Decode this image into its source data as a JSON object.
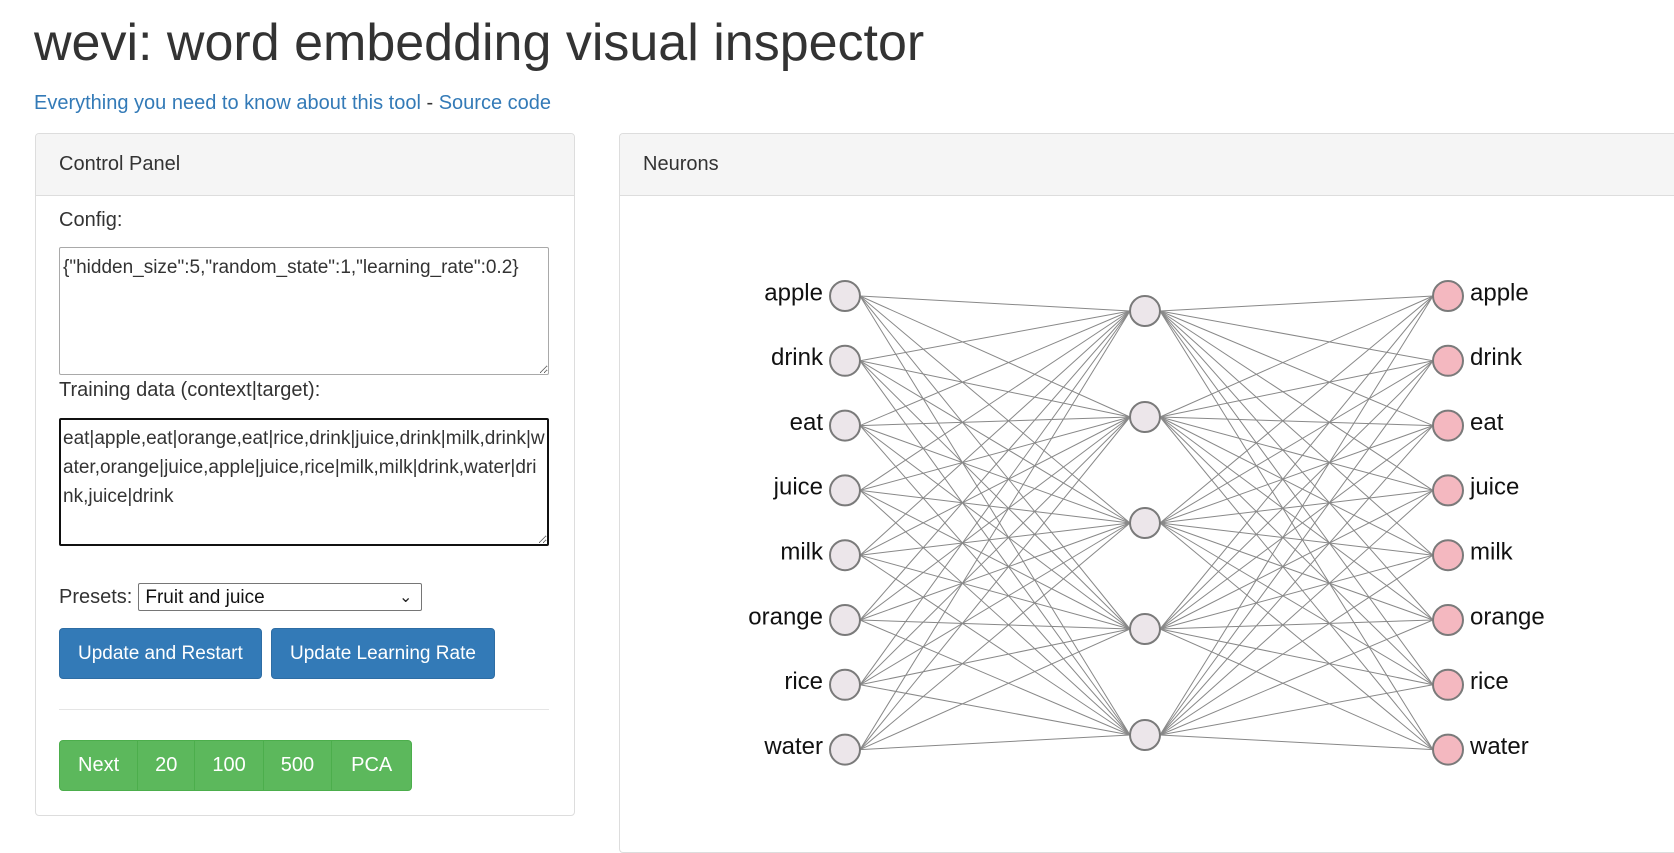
{
  "header": {
    "title": "wevi: word embedding visual inspector",
    "link_about": "Everything you need to know about this tool",
    "separator": "-",
    "link_source": "Source code"
  },
  "control_panel": {
    "heading": "Control Panel",
    "config_label": "Config:",
    "config_value": "{\"hidden_size\":5,\"random_state\":1,\"learning_rate\":0.2}",
    "training_label": "Training data (context|target):",
    "training_value": "eat|apple,eat|orange,eat|rice,drink|juice,drink|milk,drink|water,orange|juice,apple|juice,rice|milk,milk|drink,water|drink,juice|drink",
    "presets_label": "Presets:",
    "preset_selected": "Fruit and juice",
    "update_restart_label": "Update and Restart",
    "update_lr_label": "Update Learning Rate",
    "step_buttons": [
      "Next",
      "20",
      "100",
      "500",
      "PCA"
    ]
  },
  "neurons_panel": {
    "heading": "Neurons",
    "input_words": [
      "apple",
      "drink",
      "eat",
      "juice",
      "milk",
      "orange",
      "rice",
      "water"
    ],
    "output_words": [
      "apple",
      "drink",
      "eat",
      "juice",
      "milk",
      "orange",
      "rice",
      "water"
    ],
    "hidden_size": 5,
    "colors": {
      "input_fill": "#ece6ea",
      "output_fill": "#f4b8c0",
      "connection": "#888888"
    }
  }
}
